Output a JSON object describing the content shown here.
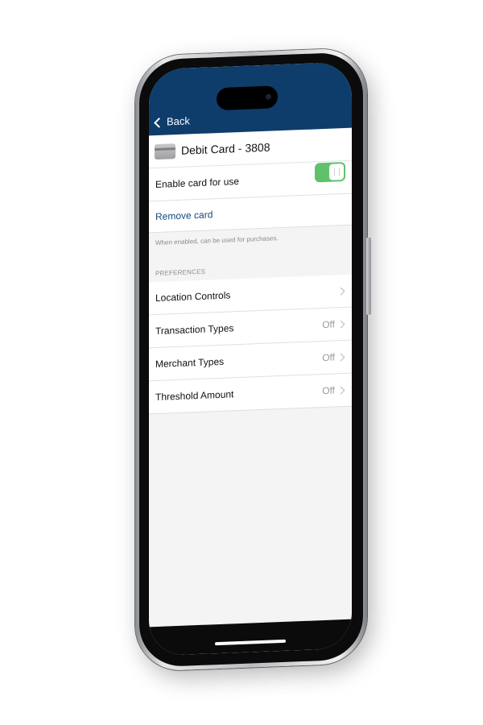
{
  "navbar": {
    "back_label": "Back",
    "color": "#0e3d6b"
  },
  "card": {
    "title": "Debit Card - 3808",
    "icon": "credit-card-icon"
  },
  "enable": {
    "label": "Enable card for use",
    "enabled": true,
    "toggle_color": "#5fc26b"
  },
  "remove": {
    "label": "Remove card",
    "color": "#17497b"
  },
  "footnote": "When enabled, can be used for purchases.",
  "preferences": {
    "header": "PREFERENCES",
    "items": [
      {
        "label": "Location Controls",
        "value": ""
      },
      {
        "label": "Transaction Types",
        "value": "Off"
      },
      {
        "label": "Merchant Types",
        "value": "Off"
      },
      {
        "label": "Threshold Amount",
        "value": "Off"
      }
    ]
  }
}
